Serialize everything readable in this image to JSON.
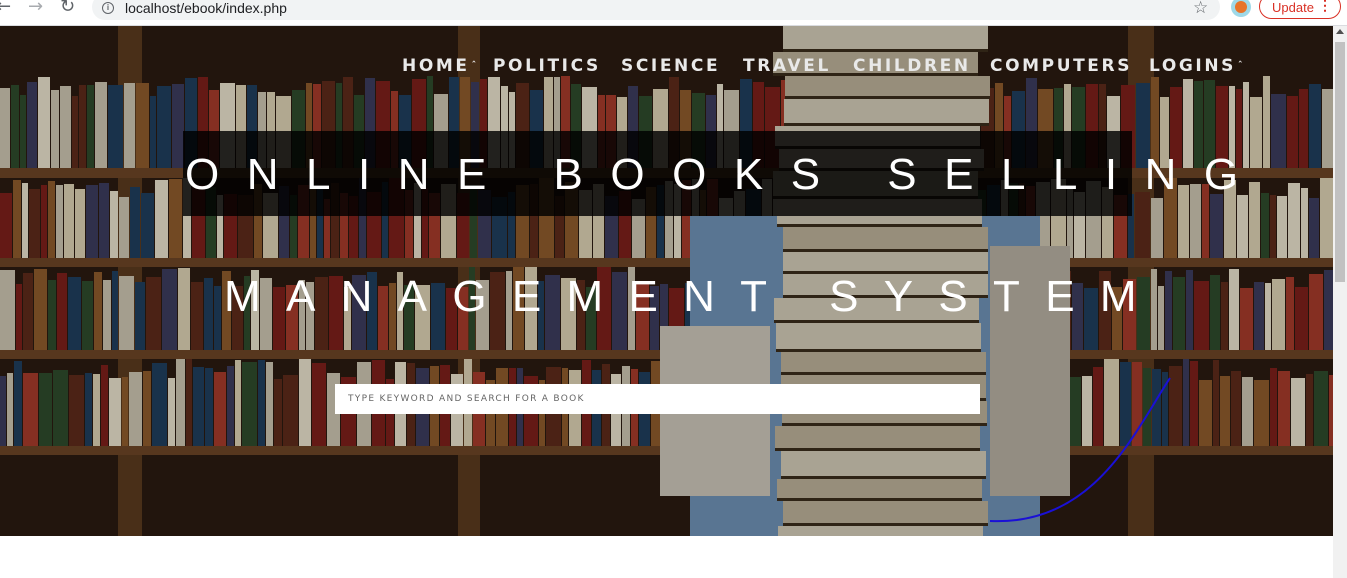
{
  "browser": {
    "url": "localhost/ebook/index.php",
    "update_label": "Update",
    "icons": [
      "back-arrow-icon",
      "forward-arrow-icon",
      "reload-icon",
      "site-info-icon",
      "star-icon",
      "extension-icon",
      "menu-dots-icon"
    ]
  },
  "nav": {
    "items": [
      {
        "label": "HOME",
        "dropdown": true
      },
      {
        "label": "POLITICS",
        "dropdown": false
      },
      {
        "label": "SCIENCE",
        "dropdown": false
      },
      {
        "label": "TRAVEL",
        "dropdown": false
      },
      {
        "label": "CHILDREN",
        "dropdown": false
      },
      {
        "label": "COMPUTERS",
        "dropdown": false
      },
      {
        "label": "LOGINS",
        "dropdown": true
      }
    ]
  },
  "hero": {
    "title_line1": "ONLINE BOOKS SELLING",
    "title_line2": "MANAGEMENT SYSTEM",
    "search_placeholder": "TYPE KEYWORD AND SEARCH FOR A BOOK"
  },
  "colors": {
    "title_box": "#000000",
    "nav_text": "#e9e9e9",
    "update_red": "#d93025",
    "annotation_curve": "#1a10d6"
  }
}
